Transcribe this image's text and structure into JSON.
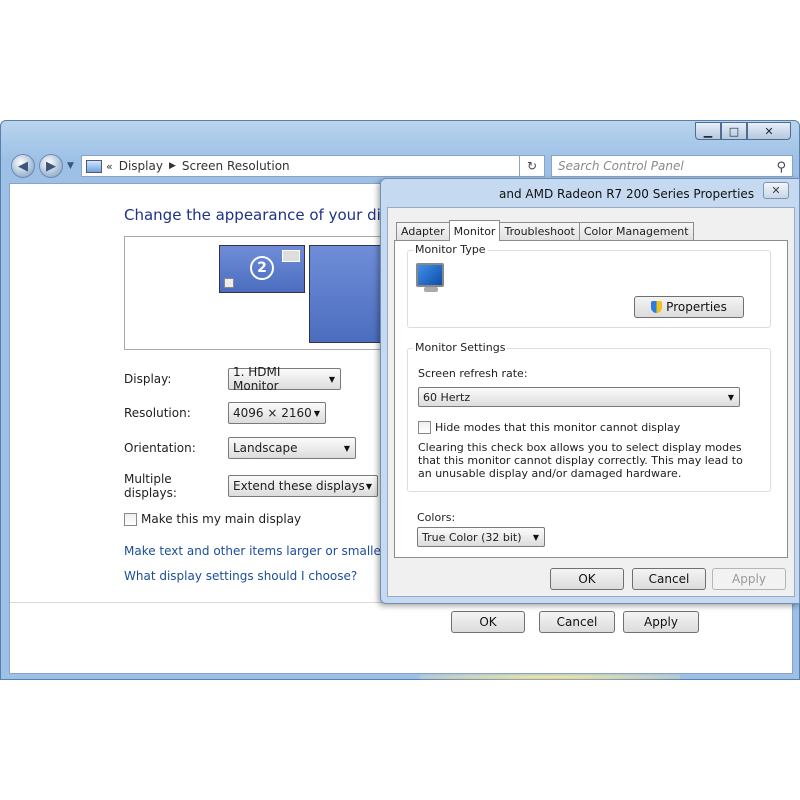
{
  "window": {
    "nav": {
      "back_icon": "back-arrow-icon",
      "forward_icon": "forward-arrow-icon"
    },
    "address": {
      "chevron": "«",
      "crumbs": [
        "Display",
        "Screen Resolution"
      ]
    },
    "search_placeholder": "Search Control Panel"
  },
  "screen_resolution": {
    "title": "Change the appearance of your displays",
    "monitor_badge": "2",
    "display_label": "Display:",
    "display_value": "1. HDMI Monitor",
    "resolution_label": "Resolution:",
    "resolution_value": "4096 × 2160",
    "orientation_label": "Orientation:",
    "orientation_value": "Landscape",
    "multiple_label": "Multiple displays:",
    "multiple_value": "Extend these displays",
    "main_display_label": "Make this my main display",
    "link_text_size": "Make text and other items larger or smaller",
    "link_help": "What display settings should I choose?",
    "ok": "OK",
    "cancel": "Cancel",
    "apply": "Apply"
  },
  "dialog": {
    "title": "and AMD Radeon R7 200 Series Properties",
    "tabs": [
      "Adapter",
      "Monitor",
      "Troubleshoot",
      "Color Management"
    ],
    "active_tab": "Monitor",
    "monitor_type_label": "Monitor Type",
    "properties_button": "Properties",
    "monitor_settings_label": "Monitor Settings",
    "refresh_label": "Screen refresh rate:",
    "refresh_value": "60 Hertz",
    "hide_modes_label": "Hide modes that this monitor cannot display",
    "hide_modes_desc": "Clearing this check box allows you to select display modes that this monitor cannot display correctly. This may lead to an unusable display and/or damaged hardware.",
    "colors_label": "Colors:",
    "colors_value": "True Color (32 bit)",
    "ok": "OK",
    "cancel": "Cancel",
    "apply": "Apply"
  },
  "colors": {
    "title_blue": "#1e3287",
    "link_blue": "#1a4e9a",
    "frame_blue": "#9cc0e6"
  }
}
